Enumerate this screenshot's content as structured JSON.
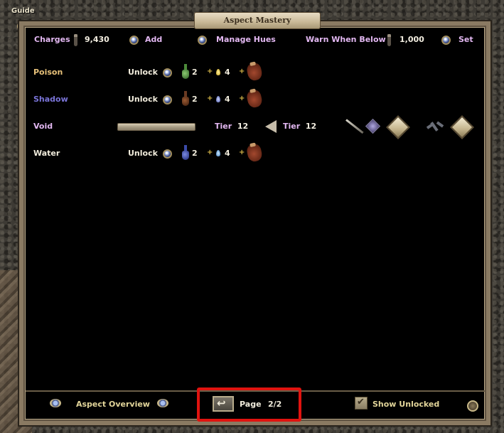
{
  "guide": {
    "label": "Guide"
  },
  "window": {
    "title": "Aspect Mastery"
  },
  "header": {
    "charges_label": "Charges",
    "charges_value": "9,430",
    "add_label": "Add",
    "manage_hues_label": "Manage Hues",
    "warn_label": "Warn When Below",
    "warn_value": "1,000",
    "set_label": "Set"
  },
  "aspects": [
    {
      "name": "Poison",
      "name_color": "#e8c27a",
      "action": "Unlock",
      "flask_color": "#4c8a3a",
      "flask_count": "2",
      "gem_color": "#e8d24a",
      "gem_count": "4"
    },
    {
      "name": "Shadow",
      "name_color": "#7a74d8",
      "action": "Unlock",
      "flask_color": "#6a3a22",
      "flask_count": "2",
      "gem_color": "#7f8fd0",
      "gem_count": "4"
    },
    {
      "name": "Void",
      "name_color": "#e3b8f2",
      "tier_current_label": "Tier",
      "tier_current": "12",
      "tier_next_label": "Tier",
      "tier_next": "12"
    },
    {
      "name": "Water",
      "name_color": "#f1ecdc",
      "action": "Unlock",
      "flask_color": "#3a4aa8",
      "flask_count": "2",
      "gem_color": "#6aa8e0",
      "gem_count": "4"
    }
  ],
  "footer": {
    "overview_label": "Aspect Overview",
    "page_label": "Page",
    "page_value": "2/2",
    "show_unlocked_label": "Show Unlocked",
    "show_unlocked_checked": true
  },
  "colors": {
    "accent_label": "#e3b8f2",
    "footer_text": "#e2d59a",
    "value_text": "#f4efe2"
  }
}
